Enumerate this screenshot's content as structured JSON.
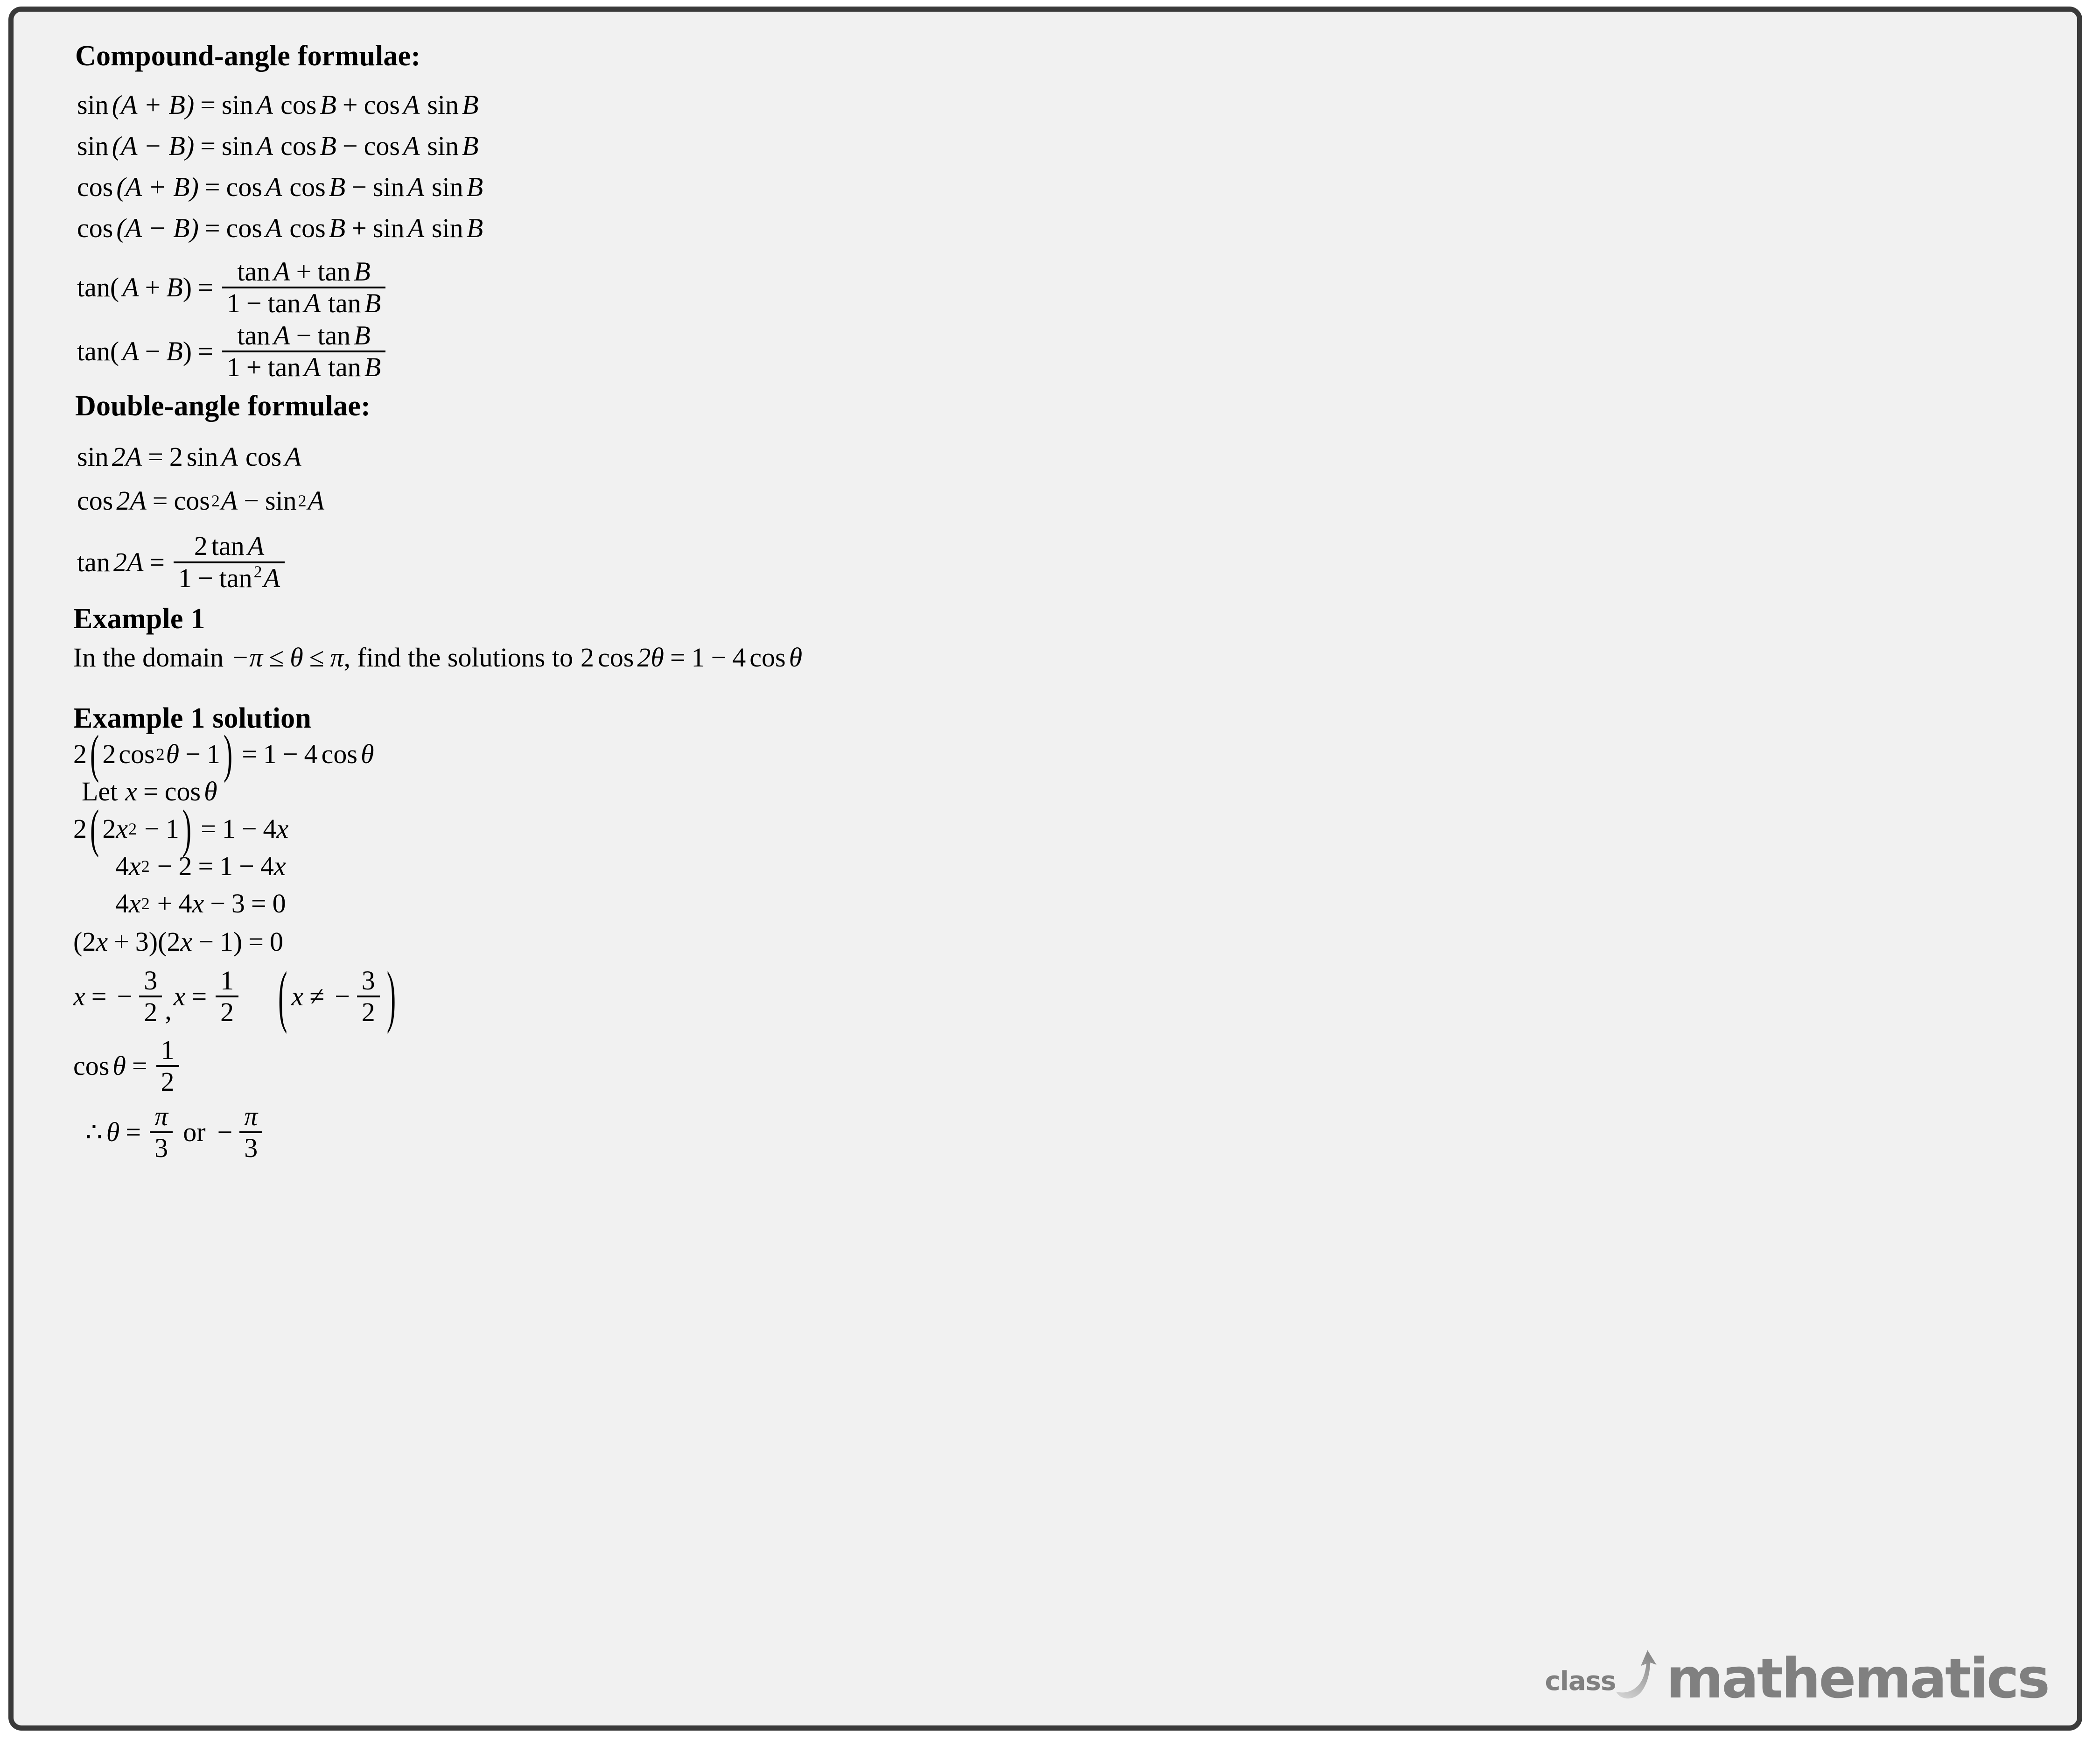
{
  "document": {
    "background_color": "#f1f1f1",
    "border_color": "#3a3a3a",
    "text_color": "#000000"
  },
  "sections": {
    "compound_heading": "Compound-angle formulae:",
    "double_heading": "Double-angle formulae:",
    "example_heading": "Example 1",
    "solution_heading": "Example 1 solution"
  },
  "compound_formulae": [
    {
      "lhs_fn": "sin",
      "lhs_args": "(A + B)",
      "rhs": "sin A cos B + cos A sin B",
      "parts": {
        "f1": "sin",
        "a1": "A",
        "f2": "cos",
        "a2": "B",
        "sign": "+",
        "f3": "cos",
        "a3": "A",
        "f4": "sin",
        "a4": "B"
      }
    },
    {
      "lhs_fn": "sin",
      "lhs_args": "(A − B)",
      "rhs": "sin A cos B − cos A sin B",
      "parts": {
        "f1": "sin",
        "a1": "A",
        "f2": "cos",
        "a2": "B",
        "sign": "−",
        "f3": "cos",
        "a3": "A",
        "f4": "sin",
        "a4": "B"
      }
    },
    {
      "lhs_fn": "cos",
      "lhs_args": "(A + B)",
      "rhs": "cos A cos B − sin A sin B",
      "parts": {
        "f1": "cos",
        "a1": "A",
        "f2": "cos",
        "a2": "B",
        "sign": "−",
        "f3": "sin",
        "a3": "A",
        "f4": "sin",
        "a4": "B"
      }
    },
    {
      "lhs_fn": "cos",
      "lhs_args": "(A − B)",
      "rhs": "cos A cos B + sin A sin B",
      "parts": {
        "f1": "cos",
        "a1": "A",
        "f2": "cos",
        "a2": "B",
        "sign": "+",
        "f3": "sin",
        "a3": "A",
        "f4": "sin",
        "a4": "B"
      }
    }
  ],
  "tan_compound": [
    {
      "lhs": "tan(A + B)",
      "numerator": "tan A + tan B",
      "denominator": "1 − tan A tan B",
      "num_sign": "+",
      "den_sign": "−"
    },
    {
      "lhs": "tan(A − B)",
      "numerator": "tan A − tan B",
      "denominator": "1 + tan A tan B",
      "num_sign": "−",
      "den_sign": "+"
    }
  ],
  "double_formulae": {
    "sin2a": {
      "lhs_fn": "sin",
      "lhs_arg": "2A",
      "rhs": "2 sin A cos A",
      "coef": "2",
      "f1": "sin",
      "a1": "A",
      "f2": "cos",
      "a2": "A"
    },
    "cos2a": {
      "lhs_fn": "cos",
      "lhs_arg": "2A",
      "rhs": "cos² A − sin² A",
      "f1": "cos",
      "p1": "2",
      "a1": "A",
      "sign": "−",
      "f2": "sin",
      "p2": "2",
      "a2": "A"
    },
    "tan2a": {
      "lhs": "tan 2A",
      "numerator": "2 tan A",
      "denominator": "1 − tan² A",
      "num_coef": "2",
      "num_fn": "tan",
      "num_arg": "A",
      "den_one": "1",
      "den_sign": "−",
      "den_fn": "tan",
      "den_pow": "2",
      "den_arg": "A"
    }
  },
  "example": {
    "question_prefix": "In the domain",
    "domain_lower": "−π",
    "domain_rel1": "≤",
    "domain_var": "θ",
    "domain_rel2": "≤",
    "domain_upper": "π",
    "question_mid": ", find the solutions to",
    "equation": "2 cos 2θ = 1 − 4 cos θ",
    "eq_parts": {
      "c1": "2",
      "fn1": "cos",
      "arg1": "2θ",
      "eq": "=",
      "one": "1",
      "minus": "−",
      "c2": "4",
      "fn2": "cos",
      "arg2": "θ"
    }
  },
  "solution": {
    "step1": {
      "outer_coef": "2",
      "inner_coef": "2",
      "inner_fn": "cos",
      "inner_pow": "2",
      "inner_arg": "θ",
      "inner_sign": "−",
      "inner_const": "1",
      "eq": "=",
      "rhs_one": "1",
      "rhs_sign": "−",
      "rhs_coef": "4",
      "rhs_fn": "cos",
      "rhs_arg": "θ",
      "text": "2(2cos²θ − 1) = 1 − 4cosθ"
    },
    "step2": {
      "let": "Let",
      "var": "x",
      "eq": "=",
      "fn": "cos",
      "arg": "θ",
      "text": "Let x = cosθ"
    },
    "step3": {
      "outer_coef": "2",
      "inner_coef": "2",
      "inner_var": "x",
      "inner_pow": "2",
      "inner_sign": "−",
      "inner_const": "1",
      "eq": "=",
      "rhs_one": "1",
      "rhs_sign": "−",
      "rhs_coef": "4",
      "rhs_var": "x",
      "text": "2(2x² − 1) = 1 − 4x"
    },
    "step4": {
      "coef": "4",
      "var": "x",
      "pow": "2",
      "sign": "−",
      "const": "2",
      "eq": "=",
      "rhs_one": "1",
      "rhs_sign": "−",
      "rhs_coef": "4",
      "rhs_var": "x",
      "text": "4x² − 2 = 1 − 4x"
    },
    "step5": {
      "coef": "4",
      "var": "x",
      "pow": "2",
      "sign1": "+",
      "coef2": "4",
      "var2": "x",
      "sign2": "−",
      "const": "3",
      "eq": "=",
      "zero": "0",
      "text": "4x² + 4x − 3 = 0"
    },
    "step6": {
      "f1_c": "2",
      "f1_v": "x",
      "f1_s": "+",
      "f1_k": "3",
      "f2_c": "2",
      "f2_v": "x",
      "f2_s": "−",
      "f2_k": "1",
      "eq": "=",
      "zero": "0",
      "text": "(2x + 3)(2x − 1) = 0"
    },
    "step7": {
      "var": "x",
      "eq": "=",
      "neg": "−",
      "root1_num": "3",
      "root1_den": "2",
      "comma": ",",
      "var2": "x",
      "eq2": "=",
      "root2_num": "1",
      "root2_den": "2",
      "note_var": "x",
      "note_rel": "≠",
      "note_neg": "−",
      "note_num": "3",
      "note_den": "2",
      "text": "x = −3/2, x = 1/2   (x ≠ −3/2)"
    },
    "step8": {
      "fn": "cos",
      "arg": "θ",
      "eq": "=",
      "num": "1",
      "den": "2",
      "text": "cosθ = 1/2"
    },
    "step9": {
      "therefore": "∴",
      "var": "θ",
      "eq": "=",
      "ans1_num": "π",
      "ans1_den": "3",
      "or": "or",
      "neg": "−",
      "ans2_num": "π",
      "ans2_den": "3",
      "text": "∴ θ = π/3 or −π/3"
    }
  },
  "logo": {
    "class_text": "class",
    "mathematics_text": "mathematics",
    "color": "#808080",
    "swoosh_icon": "swoosh-arrow-icon"
  }
}
